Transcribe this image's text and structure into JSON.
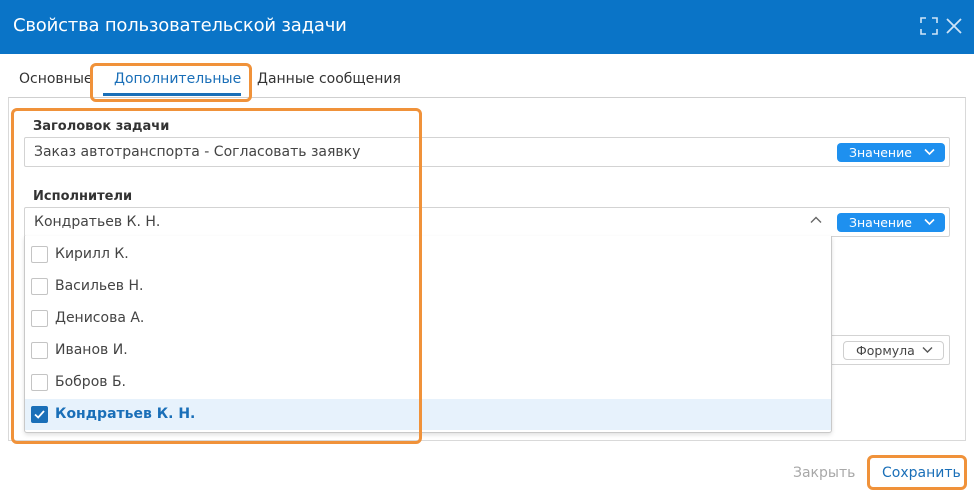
{
  "dialog": {
    "title": "Свойства пользовательской задачи"
  },
  "tabs": [
    {
      "label": "Основные"
    },
    {
      "label": "Дополнительные",
      "active": true
    },
    {
      "label": "Данные сообщения"
    }
  ],
  "fields": {
    "task_title": {
      "label": "Заголовок задачи",
      "value": "Заказ автотранспорта - Согласовать заявку",
      "mode": "Значение"
    },
    "performers": {
      "label": "Исполнители",
      "value": "Кондратьев К. Н.",
      "mode": "Значение",
      "options": [
        {
          "label": "Кирилл К.",
          "checked": false
        },
        {
          "label": "Васильев Н.",
          "checked": false
        },
        {
          "label": "Денисова А.",
          "checked": false
        },
        {
          "label": "Иванов И.",
          "checked": false
        },
        {
          "label": "Бобров Б.",
          "checked": false
        },
        {
          "label": "Кондратьев К. Н.",
          "checked": true
        }
      ]
    },
    "hidden_field": {
      "mode": "Формула"
    }
  },
  "footer": {
    "close_label": "Закрыть",
    "save_label": "Сохранить"
  },
  "colors": {
    "titlebar": "#0a74c7",
    "accent": "#1a6fb8",
    "pill_blue": "#1e90ef",
    "highlight": "#f0923a"
  },
  "icons": {
    "maximize": "maximize-icon",
    "close": "close-icon",
    "chevron_down": "chevron-down-icon",
    "chevron_up": "chevron-up-icon",
    "check": "check-icon"
  }
}
